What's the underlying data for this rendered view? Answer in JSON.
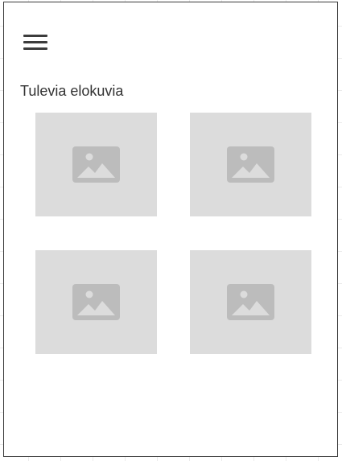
{
  "header": {
    "menu_icon": "hamburger-menu-icon"
  },
  "section": {
    "title": "Tulevia elokuvia"
  },
  "movies": [
    {
      "icon": "image-placeholder-icon"
    },
    {
      "icon": "image-placeholder-icon"
    },
    {
      "icon": "image-placeholder-icon"
    },
    {
      "icon": "image-placeholder-icon"
    }
  ],
  "colors": {
    "placeholder_bg": "#dcdcdc",
    "placeholder_icon": "#bcbcbc",
    "text": "#333333",
    "frame_border": "#3a3a3a"
  }
}
